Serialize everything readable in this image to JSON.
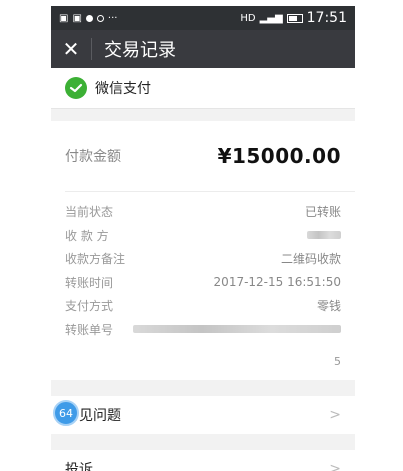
{
  "statusbar": {
    "left_icons": [
      "notification-icon",
      "notification-icon",
      "dot-icon",
      "ring-icon",
      "more-icon"
    ],
    "hd": "HD",
    "time": "17:51"
  },
  "titlebar": {
    "close_glyph": "✕",
    "title": "交易记录"
  },
  "payment": {
    "provider": "微信支付",
    "amount_label": "付款金额",
    "amount": "¥15000.00"
  },
  "details": [
    {
      "label": "当前状态",
      "value": "已转账"
    },
    {
      "label": "收 款 方",
      "value": ""
    },
    {
      "label": "收款方备注",
      "value": "二维码收款"
    },
    {
      "label": "转账时间",
      "value": "2017-12-15 16:51:50"
    },
    {
      "label": "支付方式",
      "value": "零钱"
    },
    {
      "label": "转账单号",
      "value": ""
    }
  ],
  "detail_tail": "5",
  "list": [
    {
      "label": "常见问题"
    },
    {
      "label": "投诉"
    }
  ],
  "badge": "64",
  "colors": {
    "titlebar": "#393a3f",
    "wechat_green": "#3cb035",
    "badge_blue": "#3f9be8"
  }
}
